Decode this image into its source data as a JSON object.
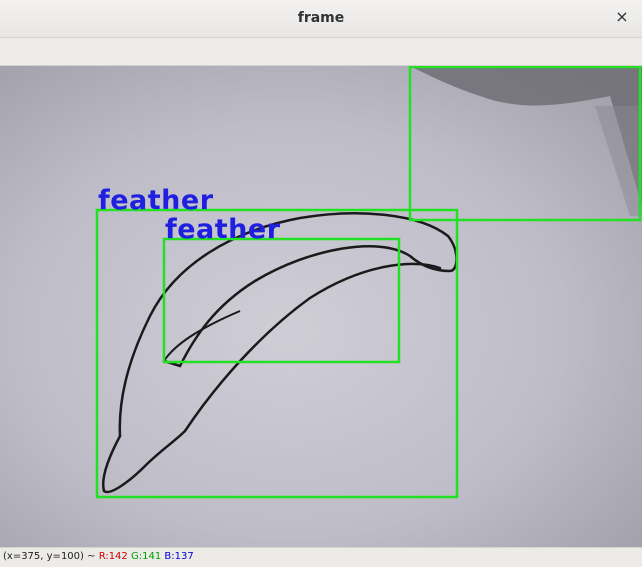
{
  "window": {
    "title": "frame",
    "close_glyph": "×"
  },
  "detections": [
    {
      "label": "feather"
    },
    {
      "label": "feather"
    },
    {
      "label": ""
    }
  ],
  "status": {
    "coords": "(x=375, y=100) ~",
    "r": "R:142",
    "g": "G:141",
    "b": "B:137"
  },
  "colors": {
    "box": "#22e022",
    "label": "#1f1fe0"
  }
}
